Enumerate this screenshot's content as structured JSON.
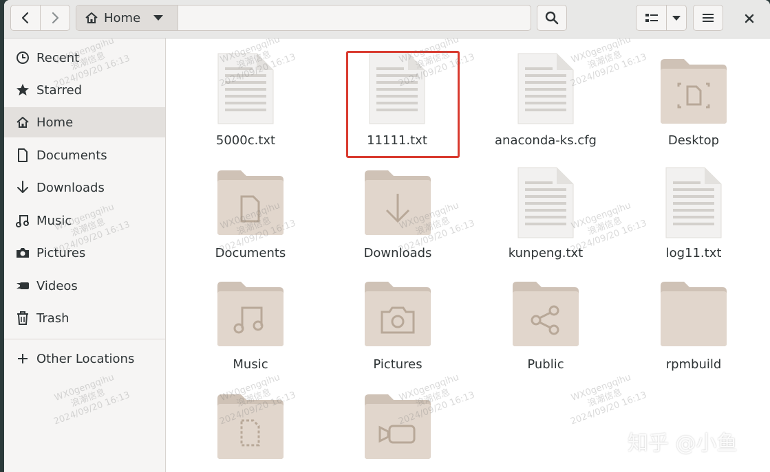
{
  "window": {
    "path_home_label": "Home"
  },
  "sidebar": {
    "items": [
      {
        "label": "Recent",
        "icon": "clock-icon"
      },
      {
        "label": "Starred",
        "icon": "star-icon"
      },
      {
        "label": "Home",
        "icon": "home-icon",
        "active": true
      },
      {
        "label": "Documents",
        "icon": "document-icon"
      },
      {
        "label": "Downloads",
        "icon": "download-icon"
      },
      {
        "label": "Music",
        "icon": "music-icon"
      },
      {
        "label": "Pictures",
        "icon": "camera-icon"
      },
      {
        "label": "Videos",
        "icon": "video-icon"
      },
      {
        "label": "Trash",
        "icon": "trash-icon"
      }
    ],
    "other_locations": "Other Locations"
  },
  "files": [
    {
      "name": "5000c.txt",
      "kind": "text"
    },
    {
      "name": "11111.txt",
      "kind": "text",
      "highlighted": true
    },
    {
      "name": "anaconda-ks.cfg",
      "kind": "text"
    },
    {
      "name": "Desktop",
      "kind": "folder-desktop"
    },
    {
      "name": "Documents",
      "kind": "folder-documents"
    },
    {
      "name": "Downloads",
      "kind": "folder-downloads"
    },
    {
      "name": "kunpeng.txt",
      "kind": "text"
    },
    {
      "name": "log11.txt",
      "kind": "text"
    },
    {
      "name": "Music",
      "kind": "folder-music"
    },
    {
      "name": "Pictures",
      "kind": "folder-pictures"
    },
    {
      "name": "Public",
      "kind": "folder-public"
    },
    {
      "name": "rpmbuild",
      "kind": "folder"
    },
    {
      "name": "",
      "kind": "folder-templates"
    },
    {
      "name": "",
      "kind": "folder-videos"
    }
  ],
  "watermark": {
    "line1": "WX0gengqihu",
    "line2": "浪潮信息",
    "line3": "2024/09/20 16:13"
  },
  "corner_credit": "知乎 @小鱼",
  "colors": {
    "folder": "#e1d6cc",
    "folder_tab": "#cfc2b6",
    "folder_glyph": "#b8a898",
    "highlight": "#d93a2f",
    "sidebar_active": "#e3e0dd"
  }
}
